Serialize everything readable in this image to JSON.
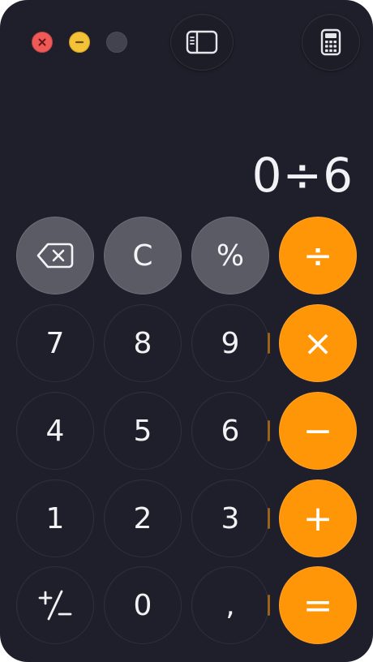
{
  "display": {
    "expression": "0÷6"
  },
  "window_controls": {
    "close_icon": "close-x-icon",
    "minimize_icon": "minus-icon",
    "zoom_icon": "zoom-icon"
  },
  "toolbar": {
    "sidebar_icon": "sidebar-icon",
    "mode_icon": "calculator-icon"
  },
  "keys": {
    "delete_icon": "backspace-icon",
    "clear": "C",
    "percent": "%",
    "divide": "÷",
    "seven": "7",
    "eight": "8",
    "nine": "9",
    "multiply": "×",
    "four": "4",
    "five": "5",
    "six": "6",
    "minus": "−",
    "one": "1",
    "two": "2",
    "three": "3",
    "plus": "+",
    "sign_icon": "plus-minus-icon",
    "zero": "0",
    "decimal": ",",
    "equals": "="
  },
  "colors": {
    "background": "#1f1f2b",
    "operator": "#ff9608",
    "function_key": "#5b5b66",
    "digit_key": "#1f1f2b"
  }
}
